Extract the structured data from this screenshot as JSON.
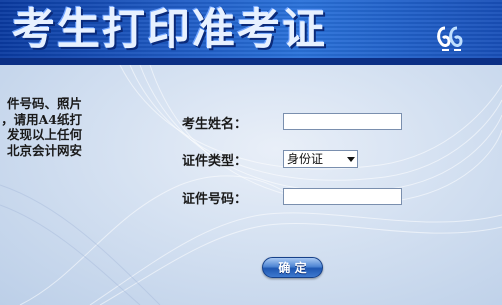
{
  "header": {
    "title": "考生打印准考证"
  },
  "notice": {
    "lines": [
      "件号码、照片",
      "，请用A4纸打",
      "发现以上任何",
      "北京会计网安"
    ]
  },
  "form": {
    "name_label": "考生姓名：",
    "name_value": "",
    "id_type_label": "证件类型：",
    "id_type_selected": "身份证",
    "id_number_label": "证件号码：",
    "id_number_value": "",
    "submit_label": "确 定"
  },
  "colors": {
    "banner": "#1f5bc4",
    "button": "#3e79cf",
    "background": "#c4d7ee"
  }
}
